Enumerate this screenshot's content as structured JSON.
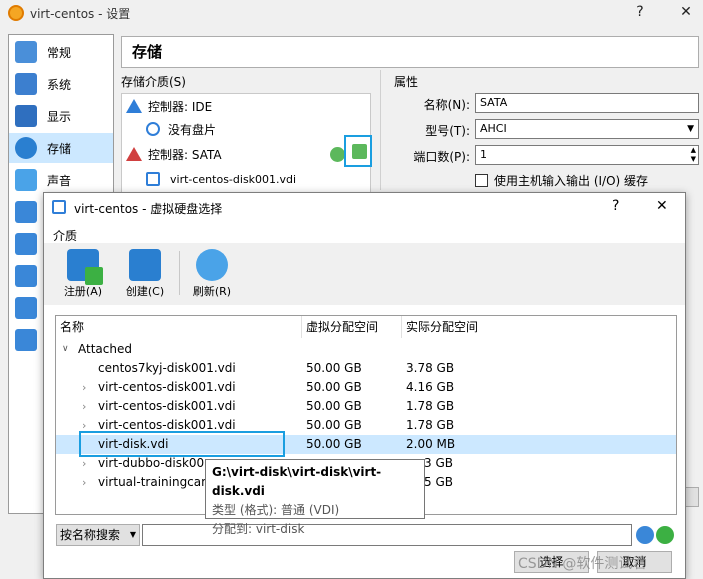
{
  "back_window": {
    "title": "virt-centos - 设置",
    "help": "?",
    "close": "✕",
    "sidebar": [
      {
        "label": "常规",
        "color": "#4a8fd9"
      },
      {
        "label": "系统",
        "color": "#3c7fcf"
      },
      {
        "label": "显示",
        "color": "#2f6fbf"
      },
      {
        "label": "存储",
        "color": "#2a7fd0",
        "selected": true
      },
      {
        "label": "声音",
        "color": "#4aa3e8"
      }
    ],
    "header": "存储",
    "storage_label": "存储介质(S)",
    "tree": [
      {
        "label": "控制器: IDE",
        "type": "controller"
      },
      {
        "label": "没有盘片",
        "type": "disc"
      },
      {
        "label": "控制器: SATA",
        "type": "controller"
      },
      {
        "label": "virt-centos-disk001.vdi",
        "type": "hdd"
      }
    ],
    "attributes": {
      "title": "属性",
      "name_label": "名称(N):",
      "name_value": "SATA",
      "type_label": "型号(T):",
      "type_value": "AHCI",
      "port_label": "端口数(P):",
      "port_value": "1",
      "cache_label": "使用主机输入输出 (I/O) 缓存"
    }
  },
  "dialog": {
    "title": "virt-centos - 虚拟硬盘选择",
    "help": "?",
    "close": "✕",
    "menu": "介质",
    "toolbar": [
      {
        "label": "注册(A)",
        "icon": "add-disk-icon"
      },
      {
        "label": "创建(C)",
        "icon": "create-disk-icon"
      },
      {
        "label": "刷新(R)",
        "icon": "refresh-icon"
      }
    ],
    "columns": [
      "名称",
      "虚拟分配空间",
      "实际分配空间"
    ],
    "group": "Attached",
    "rows": [
      {
        "name": "centos7kyj-disk001.vdi",
        "virtual": "50.00 GB",
        "actual": "3.78 GB",
        "expandable": false
      },
      {
        "name": "virt-centos-disk001.vdi",
        "virtual": "50.00 GB",
        "actual": "4.16 GB",
        "expandable": true
      },
      {
        "name": "virt-centos-disk001.vdi",
        "virtual": "50.00 GB",
        "actual": "1.78 GB",
        "expandable": true
      },
      {
        "name": "virt-centos-disk001.vdi",
        "virtual": "50.00 GB",
        "actual": "1.78 GB",
        "expandable": true
      },
      {
        "name": "virt-disk.vdi",
        "virtual": "50.00 GB",
        "actual": "2.00 MB",
        "expandable": false,
        "selected": true
      },
      {
        "name": "virt-dubbo-disk00",
        "virtual": "",
        "actual": "3 GB",
        "expandable": true
      },
      {
        "name": "virtual-trainingcam",
        "virtual": "",
        "actual": "5 GB",
        "expandable": true
      }
    ],
    "tooltip": {
      "path": "G:\\virt-disk\\virt-disk\\virt-disk.vdi",
      "type": "类型 (格式): 普通 (VDI)",
      "attached": "分配到: virt-disk"
    },
    "search_mode": "按名称搜索",
    "search_value": "",
    "select_btn": "选择",
    "cancel_btn": "取消",
    "watermark": "CSDN @软件测试君"
  }
}
